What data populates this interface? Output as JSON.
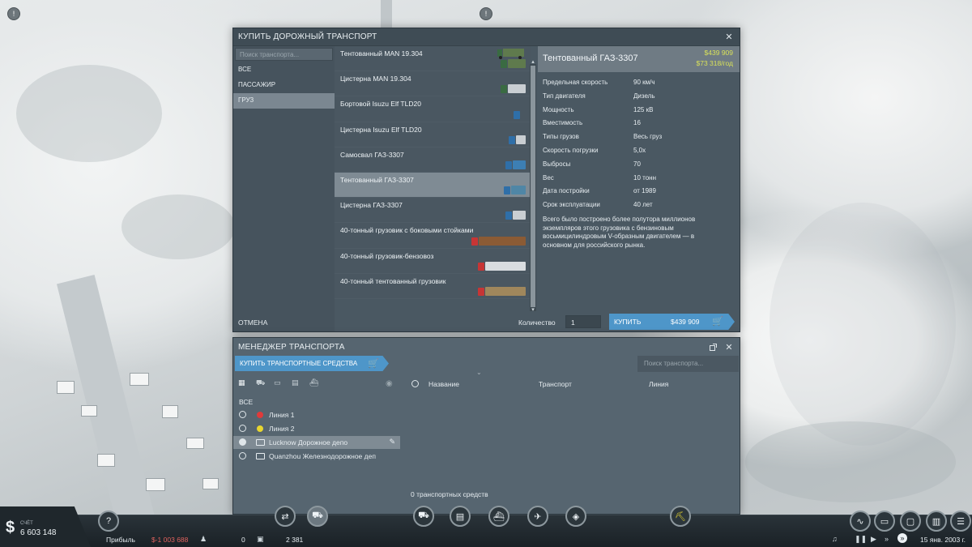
{
  "top_icons": {
    "left": "!",
    "center": "!"
  },
  "buy_window": {
    "title": "КУПИТЬ ДОРОЖНЫЙ ТРАНСПОРТ",
    "close": "✕",
    "search_placeholder": "Поиск транспорта...",
    "categories": [
      {
        "label": "ВСЕ",
        "active": false
      },
      {
        "label": "ПАССАЖИР",
        "active": false
      },
      {
        "label": "ГРУЗ",
        "active": true
      }
    ],
    "cancel_label": "ОТМЕНА",
    "vehicles": [
      {
        "name": "Тентованный MAN 19.304",
        "cab": "#3a6b42",
        "body": "#5f7a4d",
        "len": 22,
        "selected": false
      },
      {
        "name": "Цистерна MAN 19.304",
        "cab": "#3a6b42",
        "body": "#c9ced2",
        "len": 22,
        "selected": false
      },
      {
        "name": "Бортовой Isuzu Elf TLD20",
        "cab": "#2f6fa8",
        "body": "#4a5761",
        "len": 6,
        "selected": false
      },
      {
        "name": "Цистерна Isuzu Elf TLD20",
        "cab": "#2f6fa8",
        "body": "#c9ced2",
        "len": 12,
        "selected": false
      },
      {
        "name": "Самосвал ГАЗ-3307",
        "cab": "#2f6fa8",
        "body": "#3d7fb4",
        "len": 16,
        "selected": false
      },
      {
        "name": "Тентованный ГАЗ-3307",
        "cab": "#2f6fa8",
        "body": "#4f86a6",
        "len": 18,
        "selected": true
      },
      {
        "name": "Цистерна ГАЗ-3307",
        "cab": "#2f6fa8",
        "body": "#c9ced2",
        "len": 16,
        "selected": false
      },
      {
        "name": "40-тонный грузовик с боковыми стойками",
        "cab": "#c73535",
        "body": "#8b5b35",
        "len": 58,
        "selected": false
      },
      {
        "name": "40-тонный грузовик-бензовоз",
        "cab": "#c73535",
        "body": "#d9dde0",
        "len": 50,
        "selected": false
      },
      {
        "name": "40-тонный тентованный грузовик",
        "cab": "#c73535",
        "body": "#a0875c",
        "len": 50,
        "selected": false
      }
    ],
    "detail": {
      "name": "Тентованный ГАЗ-3307",
      "price": "$439 909",
      "upkeep": "$73 318/год",
      "specs": [
        {
          "key": "Предельная скорость",
          "value": "90 км/ч"
        },
        {
          "key": "Тип двигателя",
          "value": "Дизель"
        },
        {
          "key": "Мощность",
          "value": "125 кВ"
        },
        {
          "key": "Вместимость",
          "value": "16"
        },
        {
          "key": "Типы грузов",
          "value": "Весь груз"
        },
        {
          "key": "Скорость погрузки",
          "value": "5,0x"
        },
        {
          "key": "Выбросы",
          "value": "70"
        },
        {
          "key": "Вес",
          "value": "10 тонн"
        },
        {
          "key": "Дата постройки",
          "value": "от 1989"
        },
        {
          "key": "Срок эксплуатации",
          "value": "40 лет"
        }
      ],
      "description": "Всего было построено более полутора миллионов экземпляров этого грузовика с бензиновым восьмицилиндровым V-образным двигателем — в основном для российского рынка."
    },
    "quantity_label": "Количество",
    "quantity_value": "1",
    "buy_label": "КУПИТЬ",
    "buy_price": "$439 909"
  },
  "manager_window": {
    "title": "МЕНЕДЖЕР ТРАНСПОРТА",
    "close": "✕",
    "purchase_label": "КУПИТЬ ТРАНСПОРТНЫЕ СРЕДСТВА",
    "search_placeholder": "Поиск транспорта...",
    "all_label": "ВСЕ",
    "columns": {
      "name": "Название",
      "vehicle": "Транспорт",
      "line": "Линия"
    },
    "lines": [
      {
        "label": "Линия 1",
        "color": "#e03a3a",
        "type": "line",
        "selected": false
      },
      {
        "label": "Линия 2",
        "color": "#e8d630",
        "type": "line",
        "selected": false
      },
      {
        "label": "Lucknow Дорожное депо",
        "color": "",
        "type": "depot",
        "selected": true
      },
      {
        "label": "Quanzhou Железнодорожное деп",
        "color": "",
        "type": "depot",
        "selected": false
      }
    ],
    "vehicle_count": "0 транспортных средств"
  },
  "bottom_bar": {
    "money_label": "СЧЁТ",
    "money_value": "6 603 148",
    "help": "?",
    "profit_label": "Прибыль",
    "profit_value": "$-1 003 688",
    "passengers": "0",
    "cargo": "2 381",
    "date": "15 янв. 2003 г."
  },
  "colors": {
    "accent": "#4e96c9",
    "price": "#d8e15a",
    "loss": "#e0625e"
  }
}
